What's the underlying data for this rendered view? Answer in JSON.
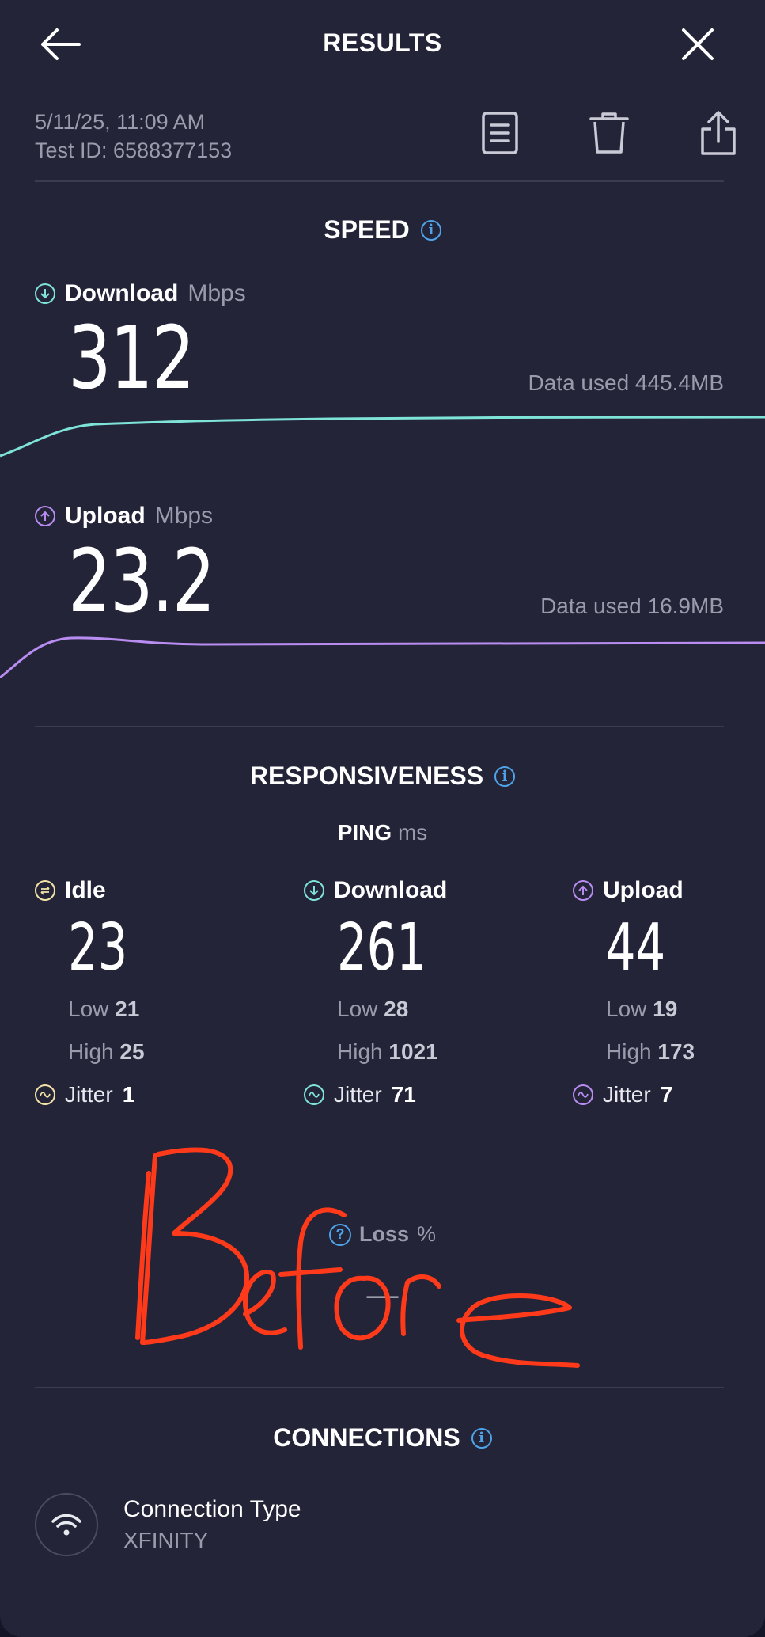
{
  "header": {
    "title": "RESULTS",
    "back_icon": "back-arrow-icon",
    "close_icon": "close-icon"
  },
  "meta": {
    "datetime": "5/11/25, 11:09 AM",
    "test_id": "Test ID: 6588377153"
  },
  "actions": [
    "document-icon",
    "trash-icon",
    "share-icon"
  ],
  "speed": {
    "title": "SPEED",
    "download": {
      "label": "Download",
      "unit": "Mbps",
      "value": "312",
      "data_used": "Data used 445.4MB",
      "color": "#7ee3d9"
    },
    "upload": {
      "label": "Upload",
      "unit": "Mbps",
      "value": "23.2",
      "data_used": "Data used 16.9MB",
      "color": "#b88cf0"
    }
  },
  "responsiveness": {
    "title": "RESPONSIVENESS",
    "ping_label": "PING",
    "ping_unit": "ms",
    "columns": [
      {
        "label": "Idle",
        "value": "23",
        "low_label": "Low",
        "low": "21",
        "high_label": "High",
        "high": "25",
        "jitter_label": "Jitter",
        "jitter": "1",
        "color": "#f3e3a6"
      },
      {
        "label": "Download",
        "value": "261",
        "low_label": "Low",
        "low": "28",
        "high_label": "High",
        "high": "1021",
        "jitter_label": "Jitter",
        "jitter": "71",
        "color": "#7ee3d9"
      },
      {
        "label": "Upload",
        "value": "44",
        "low_label": "Low",
        "low": "19",
        "high_label": "High",
        "high": "173",
        "jitter_label": "Jitter",
        "jitter": "7",
        "color": "#b88cf0"
      }
    ],
    "loss_label": "Loss",
    "loss_unit": "%",
    "loss_value": "—"
  },
  "annotation": {
    "handwritten_text": "Before",
    "color": "#ff3a1a"
  },
  "connections": {
    "title": "CONNECTIONS",
    "type_label": "Connection Type",
    "type_value": "XFINITY",
    "icon": "wifi-icon"
  },
  "colors": {
    "background": "#232438",
    "accent_info": "#4fa3e8"
  }
}
